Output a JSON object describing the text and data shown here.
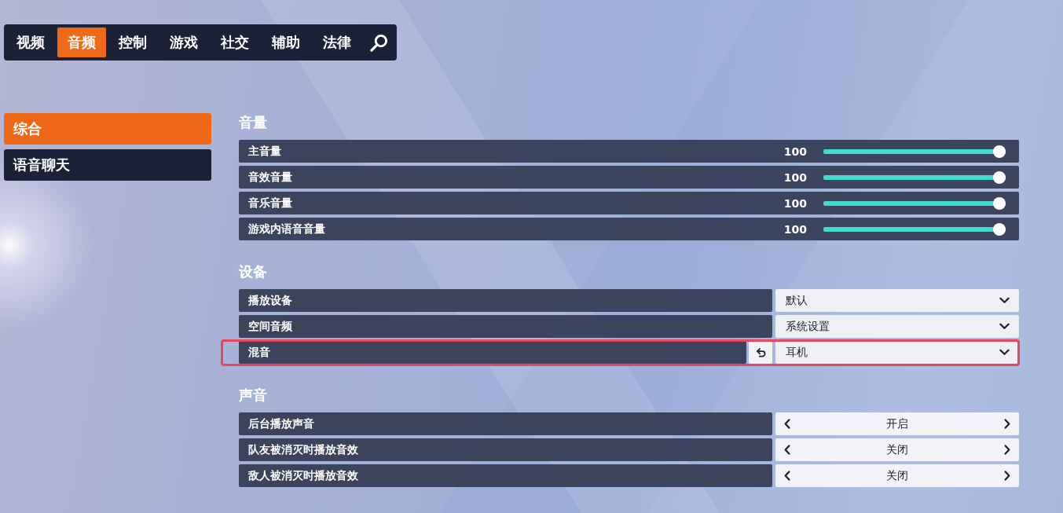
{
  "tabs": [
    {
      "label": "视频",
      "selected": false
    },
    {
      "label": "音频",
      "selected": true
    },
    {
      "label": "控制",
      "selected": false
    },
    {
      "label": "游戏",
      "selected": false
    },
    {
      "label": "社交",
      "selected": false
    },
    {
      "label": "辅助",
      "selected": false
    },
    {
      "label": "法律",
      "selected": false
    }
  ],
  "sidebar": {
    "items": [
      {
        "label": "综合",
        "selected": true
      },
      {
        "label": "语音聊天",
        "selected": false
      }
    ]
  },
  "sections": [
    {
      "title": "音量",
      "settings": [
        {
          "kind": "slider",
          "label": "主音量",
          "reading": "100",
          "level": 1
        },
        {
          "kind": "slider",
          "label": "音效音量",
          "reading": "100",
          "level": 1
        },
        {
          "kind": "slider",
          "label": "音乐音量",
          "reading": "100",
          "level": 1
        },
        {
          "kind": "slider",
          "label": "游戏内语音音量",
          "reading": "100",
          "level": 1
        }
      ]
    },
    {
      "title": "设备",
      "settings": [
        {
          "kind": "dropdown",
          "label": "播放设备",
          "value": "默认",
          "reset": false,
          "highlighted": false
        },
        {
          "kind": "dropdown",
          "label": "空间音频",
          "value": "系统设置",
          "reset": false,
          "highlighted": false
        },
        {
          "kind": "dropdown",
          "label": "混音",
          "value": "耳机",
          "reset": true,
          "highlighted": true
        }
      ]
    },
    {
      "title": "声音",
      "settings": [
        {
          "kind": "selector",
          "label": "后台播放声音",
          "value": "开启"
        },
        {
          "kind": "selector",
          "label": "队友被消灭时播放音效",
          "value": "关闭"
        },
        {
          "kind": "selector",
          "label": "敌人被消灭时播放音效",
          "value": "关闭"
        }
      ]
    }
  ]
}
